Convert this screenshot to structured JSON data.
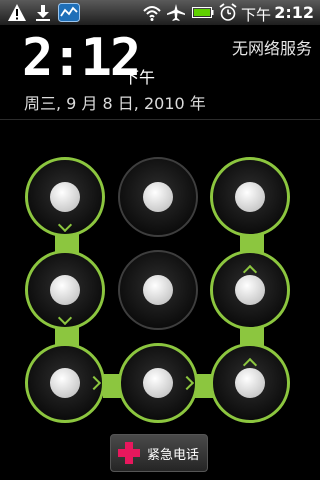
{
  "status_bar": {
    "time": "2:12",
    "ampm": "下午",
    "left_icons": [
      "warning-icon",
      "download-icon",
      "app-notification-icon"
    ],
    "right_icons": [
      "wifi-icon",
      "airplane-mode-icon",
      "battery-icon",
      "alarm-icon"
    ]
  },
  "lock": {
    "time": "2:12",
    "ampm": "下午",
    "date": "周三, 9 月 8 日, 2010 年",
    "carrier": "无网络服务"
  },
  "pattern": {
    "accent_color": "#8cc63f",
    "nodes": [
      {
        "row": 1,
        "col": 1,
        "active": true,
        "arrow": "down"
      },
      {
        "row": 1,
        "col": 2,
        "active": false,
        "arrow": ""
      },
      {
        "row": 1,
        "col": 3,
        "active": true,
        "arrow": ""
      },
      {
        "row": 2,
        "col": 1,
        "active": true,
        "arrow": "down"
      },
      {
        "row": 2,
        "col": 2,
        "active": false,
        "arrow": ""
      },
      {
        "row": 2,
        "col": 3,
        "active": true,
        "arrow": "up"
      },
      {
        "row": 3,
        "col": 1,
        "active": true,
        "arrow": "right"
      },
      {
        "row": 3,
        "col": 2,
        "active": true,
        "arrow": "right"
      },
      {
        "row": 3,
        "col": 3,
        "active": true,
        "arrow": "up"
      }
    ]
  },
  "emergency_button": {
    "label": "紧急电话",
    "icon": "plus-icon",
    "icon_color": "#e8175d"
  }
}
